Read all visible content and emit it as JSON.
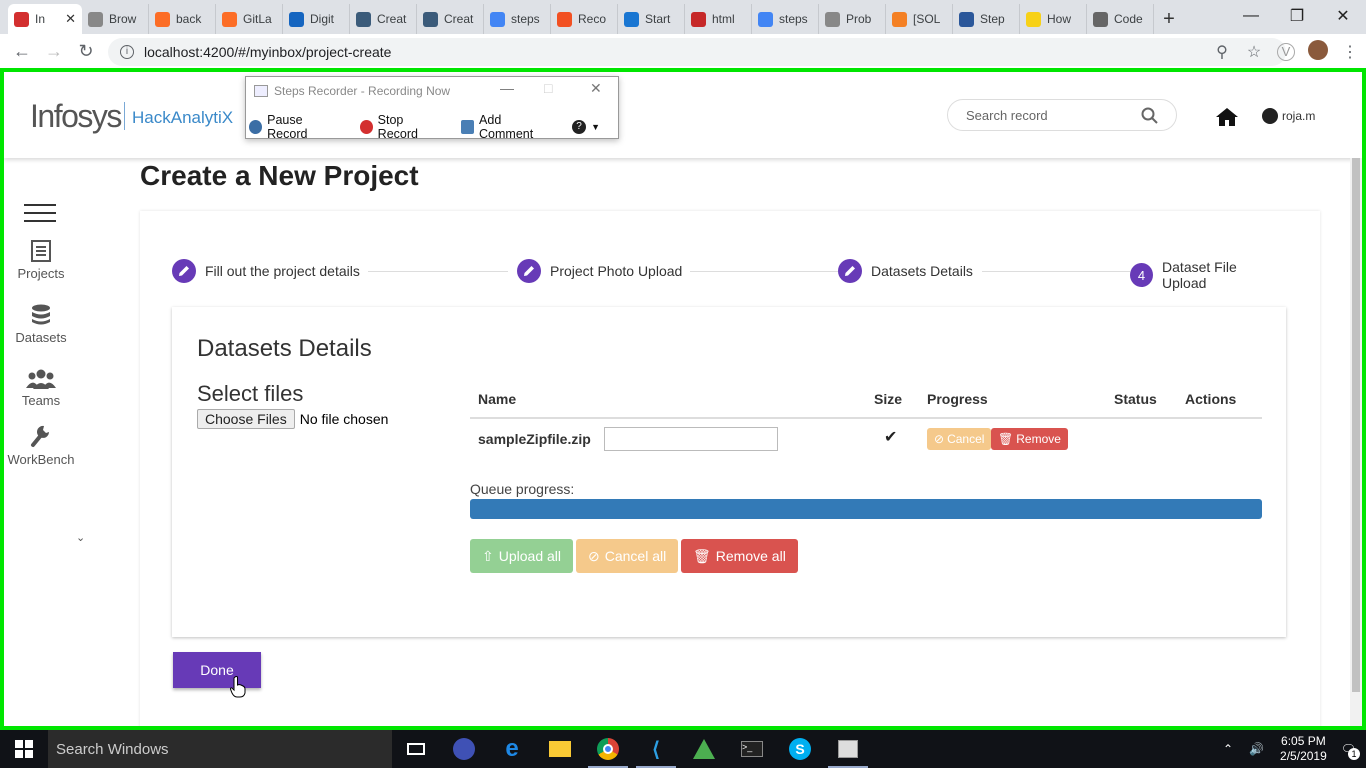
{
  "browser": {
    "tabs": [
      {
        "label": "In",
        "color": "#d32f2f"
      },
      {
        "label": "Brow",
        "color": "#888"
      },
      {
        "label": "back",
        "color": "#fc6d26"
      },
      {
        "label": "GitLa",
        "color": "#fc6d26"
      },
      {
        "label": "Digit",
        "color": "#1565c0"
      },
      {
        "label": "Creat",
        "color": "#3b5b7a"
      },
      {
        "label": "Creat",
        "color": "#3b5b7a"
      },
      {
        "label": "steps",
        "color": "#4285f4"
      },
      {
        "label": "Reco",
        "color": "#f25022"
      },
      {
        "label": "Start",
        "color": "#1976d2"
      },
      {
        "label": "html",
        "color": "#c62828"
      },
      {
        "label": "steps",
        "color": "#4285f4"
      },
      {
        "label": "Prob",
        "color": "#888"
      },
      {
        "label": "[SOL",
        "color": "#f48024"
      },
      {
        "label": "Step",
        "color": "#2b579a"
      },
      {
        "label": "How",
        "color": "#f7d117"
      },
      {
        "label": "Code",
        "color": "#666"
      }
    ],
    "url": "localhost:4200/#/myinbox/project-create"
  },
  "recorder": {
    "title": "Steps Recorder - Recording Now",
    "pause_label": "Pause Record",
    "stop_label": "Stop Record",
    "comment_label": "Add Comment"
  },
  "header": {
    "logo": "Infosys",
    "product": "HackAnalytiX",
    "search_placeholder": "Search record",
    "username": "roja.m"
  },
  "sidebar": {
    "projects": "Projects",
    "datasets": "Datasets",
    "teams": "Teams",
    "workbench": "WorkBench"
  },
  "page": {
    "title": "Create a New Project"
  },
  "stepper": {
    "steps": [
      {
        "label": "Fill out the project details",
        "marker": "edit"
      },
      {
        "label": "Project Photo Upload",
        "marker": "edit"
      },
      {
        "label": "Datasets Details",
        "marker": "edit"
      },
      {
        "label": "Dataset File Upload",
        "marker": "4"
      }
    ]
  },
  "upload": {
    "heading": "Datasets Details",
    "select_label": "Select files",
    "choose_button": "Choose Files",
    "no_file": "No file chosen",
    "columns": [
      "Name",
      "Size",
      "Progress",
      "Status",
      "Actions"
    ],
    "file": {
      "name": "sampleZipfile.zip",
      "size_mark": "✔",
      "cancel": "Cancel",
      "remove": "Remove"
    },
    "queue_label": "Queue progress:",
    "queue_progress": 1.0,
    "upload_all": "Upload all",
    "cancel_all": "Cancel all",
    "remove_all": "Remove all"
  },
  "done_button": "Done",
  "taskbar": {
    "search": "Search Windows",
    "time": "6:05 PM",
    "date": "2/5/2019",
    "notifications": "1"
  },
  "colors": {
    "accent": "#673ab7",
    "recording_frame": "#00e600",
    "success": "#5cb85c",
    "warning": "#f0ad4e",
    "danger": "#d9534f",
    "primary": "#337ab7"
  }
}
